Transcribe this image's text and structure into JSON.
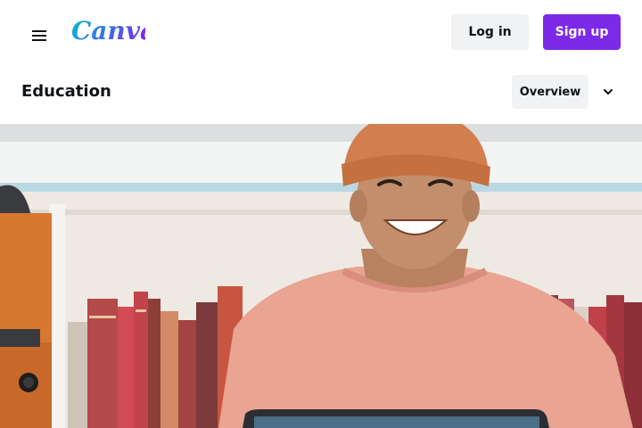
{
  "header": {
    "logo_text": "Canva",
    "login_label": "Log in",
    "signup_label": "Sign up",
    "menu_icon": "hamburger-menu-icon"
  },
  "subnav": {
    "title": "Education",
    "overview_label": "Overview",
    "dropdown_icon": "chevron-down-icon"
  },
  "hero": {
    "description": "Smiling student in orange beanie and pink t-shirt in front of a bookshelf holding a laptop"
  },
  "colors": {
    "brand_purple": "#7d2ae8",
    "button_gray": "#f1f2f4",
    "logo_gradient_start": "#00c4cc",
    "logo_gradient_end": "#7d2ae8"
  }
}
